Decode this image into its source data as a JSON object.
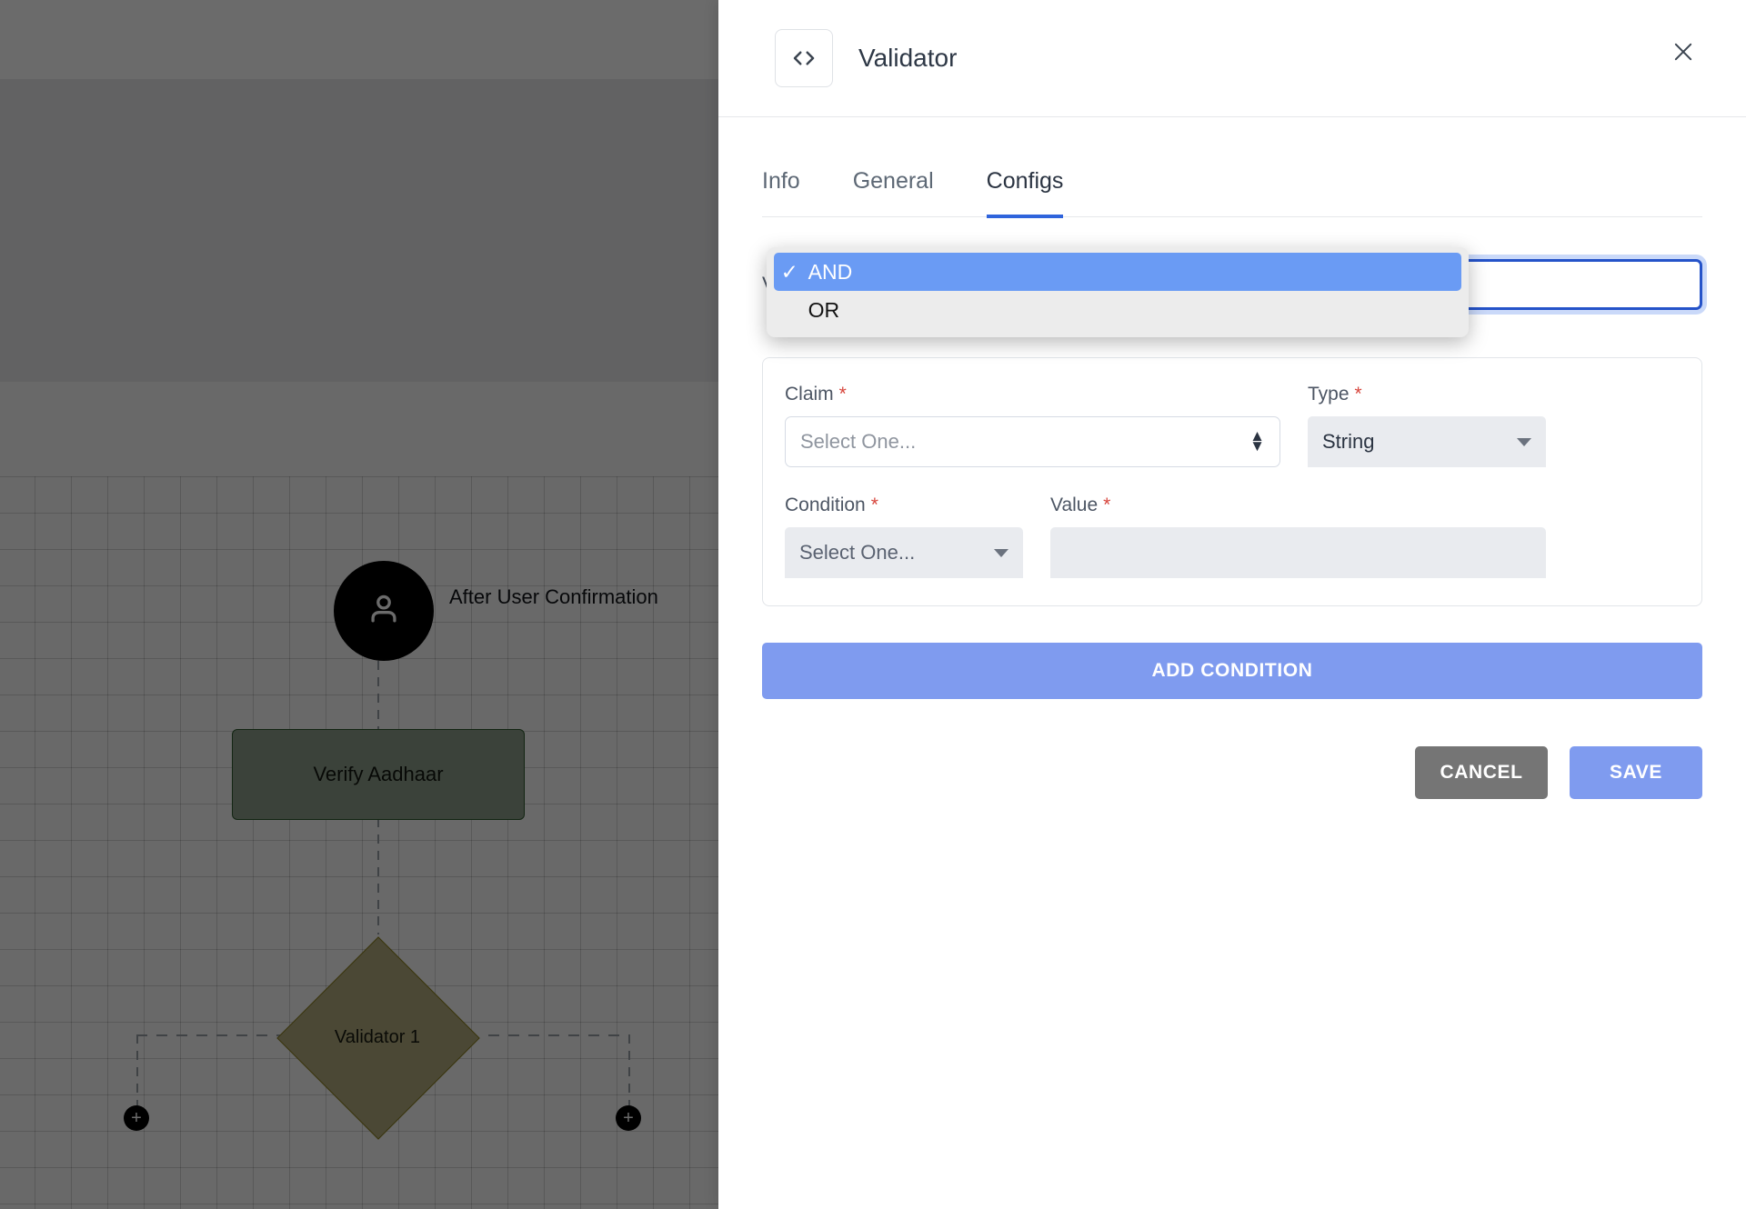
{
  "canvas": {
    "user_node": {
      "icon": "person-icon",
      "label": "After User Confirmation"
    },
    "task_node": {
      "label": "Verify Aadhaar"
    },
    "decision_node": {
      "label": "Validator 1"
    },
    "add_handles": {
      "plus": "+"
    }
  },
  "drawer": {
    "icon": "code-brackets-icon",
    "title": "Validator",
    "close_icon": "close-icon",
    "tabs": [
      {
        "label": "Info",
        "active": false
      },
      {
        "label": "General",
        "active": false
      },
      {
        "label": "Configs",
        "active": true
      }
    ],
    "validation_condition": {
      "label": "Validation Condition",
      "required_marker": "*",
      "selected": "AND",
      "options": [
        {
          "label": "AND",
          "selected": true,
          "check": "✓"
        },
        {
          "label": "OR",
          "selected": false,
          "check": ""
        }
      ]
    },
    "condition_card": {
      "claim": {
        "label": "Claim",
        "required_marker": "*",
        "value": "Select One..."
      },
      "type": {
        "label": "Type",
        "required_marker": "*",
        "value": "String"
      },
      "condition": {
        "label": "Condition",
        "required_marker": "*",
        "value": "Select One..."
      },
      "value_field": {
        "label": "Value",
        "required_marker": "*",
        "value": "",
        "placeholder": ""
      }
    },
    "add_condition_label": "ADD CONDITION",
    "cancel_label": "CANCEL",
    "save_label": "SAVE"
  },
  "colors": {
    "accent_blue": "#2f64dc",
    "button_periwinkle": "#7f9bef",
    "cancel_gray": "#757575",
    "required_red": "#d7453c",
    "highlight_blue": "#6a9bf4",
    "task_green": "#8d9d8b",
    "decision_olive": "#b3ad7e"
  }
}
